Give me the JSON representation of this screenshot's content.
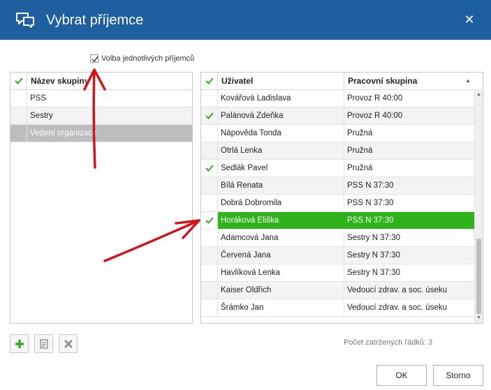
{
  "window": {
    "title": "Vybrat příjemce"
  },
  "option": {
    "label": "Volba jednotlivých příjemců",
    "checked": true
  },
  "groups": {
    "header": "Název skupiny",
    "rows": [
      {
        "name": "PSS",
        "checked": false,
        "state": "normal"
      },
      {
        "name": "Sestry",
        "checked": false,
        "state": "alt"
      },
      {
        "name": "Vedení organizace",
        "checked": false,
        "state": "selected"
      }
    ]
  },
  "users": {
    "col_user": "Uživatel",
    "col_group": "Pracovní skupina",
    "rows": [
      {
        "user": "Kovářová Ladislava",
        "group": "Provoz R 40:00",
        "checked": false,
        "state": "normal"
      },
      {
        "user": "Palánová Zdeňka",
        "group": "Provoz R 40:00",
        "checked": true,
        "state": "alt"
      },
      {
        "user": "Nápověda Tonda",
        "group": "Pružná",
        "checked": false,
        "state": "normal"
      },
      {
        "user": "Otrlá Lenka",
        "group": "Pružná",
        "checked": false,
        "state": "alt"
      },
      {
        "user": "Sedlák Pavel",
        "group": "Pružná",
        "checked": true,
        "state": "normal"
      },
      {
        "user": "Bílá Renata",
        "group": "PSS N 37:30",
        "checked": false,
        "state": "alt"
      },
      {
        "user": "Dobrá Dobromila",
        "group": "PSS N 37:30",
        "checked": false,
        "state": "normal"
      },
      {
        "user": "Horáková Eliška",
        "group": "PSS N 37:30",
        "checked": true,
        "state": "selected"
      },
      {
        "user": "Adamcová Jana",
        "group": "Sestry N 37:30",
        "checked": false,
        "state": "normal"
      },
      {
        "user": "Červená Jana",
        "group": "Sestry N 37:30",
        "checked": false,
        "state": "alt"
      },
      {
        "user": "Havlíková Lenka",
        "group": "Sestry N 37:30",
        "checked": false,
        "state": "normal"
      },
      {
        "user": "Kaiser Oldřich",
        "group": "Vedoucí zdrav. a soc. úseku",
        "checked": false,
        "state": "alt"
      },
      {
        "user": "Šrámko Jan",
        "group": "Vedoucí zdrav. a soc. úseku",
        "checked": false,
        "state": "normal"
      }
    ]
  },
  "toolbar": {
    "add_icon": "plus-icon",
    "edit_icon": "edit-icon",
    "delete_icon": "delete-icon"
  },
  "status": {
    "checked_rows": "Počet zatržených řádků: 3"
  },
  "buttons": {
    "ok": "OK",
    "cancel": "Storno"
  },
  "colors": {
    "titlebar": "#1e5fa0",
    "check": "#3aa82a",
    "selected_green": "#2fb31b",
    "selected_grey": "#bdbdbd",
    "annotation_arrow": "#d0141c"
  }
}
